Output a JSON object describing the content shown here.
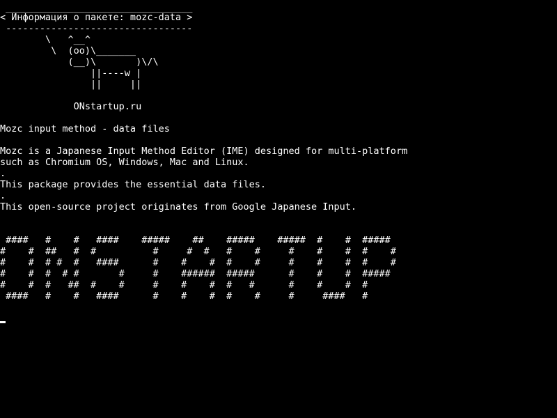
{
  "terminal": {
    "colors": {
      "background": "#000000",
      "foreground": "#ffffff"
    },
    "banner": {
      "top_border": " _________________________________",
      "title": "< Информация о пакете: mozc-data >",
      "bottom_border": " ---------------------------------"
    },
    "cow": [
      "        \\   ^__^",
      "         \\  (oo)\\_______",
      "            (__)\\       )\\/\\",
      "                ||----w |",
      "                ||     ||"
    ],
    "site_label": "             ONstartup.ru",
    "package": {
      "summary": "Mozc input method - data files",
      "description": [
        "Mozc is a Japanese Input Method Editor (IME) designed for multi-platform",
        "such as Chromium OS, Windows, Mac and Linux.",
        ".",
        "This package provides the essential data files.",
        ".",
        "This open-source project originates from Google Japanese Input."
      ]
    },
    "ascii_art_lines": [
      " ####   #    #   ####    #####    ##    #####    #####  #    #  #####",
      "#    #  ##   #  #          #     #  #   #    #     #    #    #  #    #",
      "#    #  # #  #   ####      #    #    #  #    #     #    #    #  #    #",
      "#    #  #  # #       #     #    ######  #####      #    #    #  #####",
      "#    #  #   ##  #    #     #    #    #  #   #      #    #    #  #",
      " ####   #    #   ####      #    #    #  #    #     #     ####   #"
    ]
  }
}
